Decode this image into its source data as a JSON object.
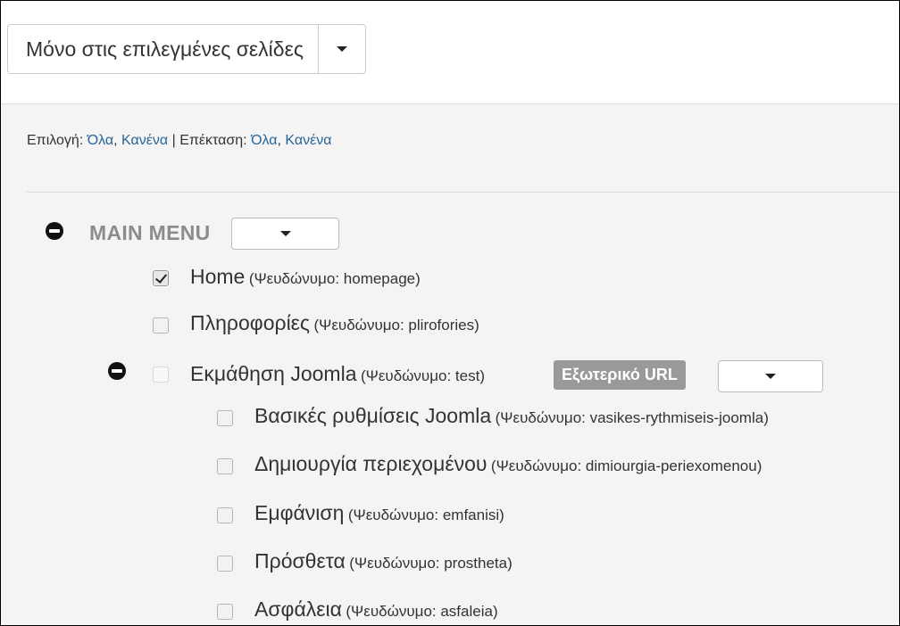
{
  "assignment_select": {
    "selected": "Μόνο στις επιλεγμένες σελίδες"
  },
  "selection_controls": {
    "select_label": "Επιλογή:",
    "select_all": "Όλα",
    "comma_1": ",",
    "select_none": "Κανένα",
    "separator": "|",
    "expand_label": "Επέκταση:",
    "expand_all": "Όλα",
    "comma_2": ",",
    "expand_none": "Κανένα"
  },
  "menu": {
    "title": "MAIN MENU",
    "items": [
      {
        "name": "Home",
        "alias": "(Ψευδώνυμο: homepage)",
        "checked": true
      },
      {
        "name": "Πληροφορίες",
        "alias": "(Ψευδώνυμο: plirofories)",
        "checked": false
      },
      {
        "name": "Εκμάθηση Joomla",
        "alias": "(Ψευδώνυμο: test)",
        "checked": false,
        "badge": "Εξωτερικό URL",
        "children": [
          {
            "name": "Βασικές ρυθμίσεις Joomla",
            "alias": "(Ψευδώνυμο: vasikes-rythmiseis-joomla)",
            "checked": false
          },
          {
            "name": "Δημιουργία περιεχομένου",
            "alias": "(Ψευδώνυμο: dimiourgia-periexomenou)",
            "checked": false
          },
          {
            "name": "Εμφάνιση",
            "alias": "(Ψευδώνυμο: emfanisi)",
            "checked": false
          },
          {
            "name": "Πρόσθετα",
            "alias": "(Ψευδώνυμο: prostheta)",
            "checked": false
          },
          {
            "name": "Ασφάλεια",
            "alias": "(Ψευδώνυμο: asfaleia)",
            "checked": false
          }
        ]
      }
    ]
  },
  "icons": {
    "collapse": "minus-circle-icon",
    "dropdown": "caret-down-icon",
    "checkbox": "checkbox-icon"
  }
}
